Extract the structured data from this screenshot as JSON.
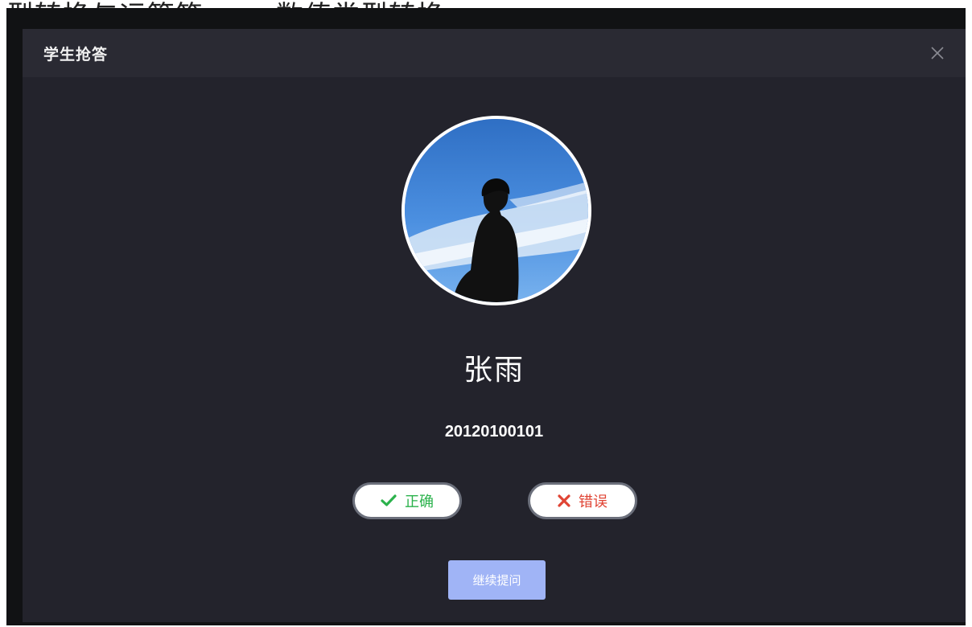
{
  "background": {
    "heading_left": "型转换与运算符",
    "heading_right": "数值类型转换"
  },
  "modal": {
    "title": "学生抢答",
    "close_icon": "close-icon"
  },
  "student": {
    "avatar_icon": "student-avatar-photo",
    "name": "张雨",
    "id": "20120100101"
  },
  "actions": {
    "correct_label": "正确",
    "correct_icon": "check-icon",
    "wrong_label": "错误",
    "wrong_icon": "cross-icon",
    "continue_label": "继续提问"
  },
  "colors": {
    "modal_bg": "#23232c",
    "header_bg": "#2a2a33",
    "correct": "#2bb24c",
    "wrong": "#e04434",
    "continue_bg": "#a0b4f6",
    "avatar_ring": "#6f8ee8"
  }
}
